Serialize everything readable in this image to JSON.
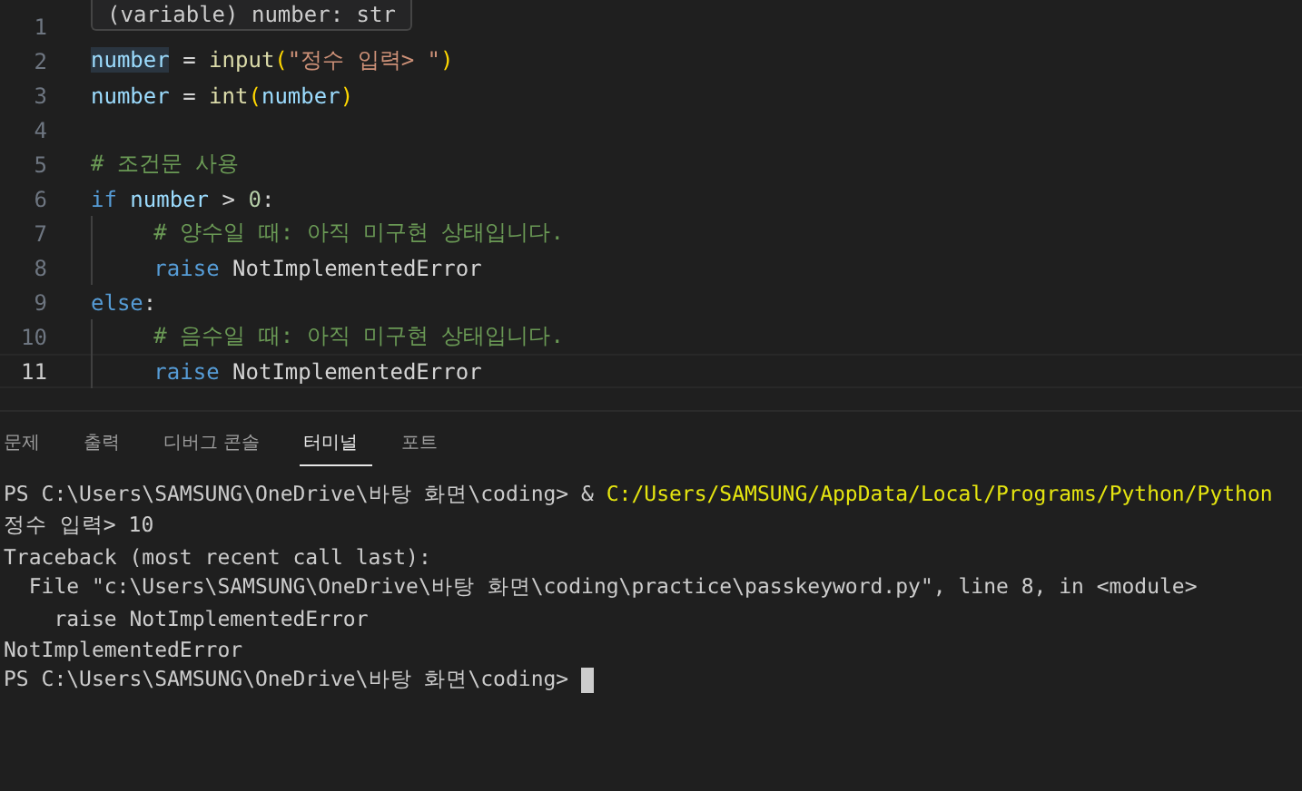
{
  "editor": {
    "tooltip": "(variable) number: str",
    "lines": [
      {
        "number": "1",
        "current": false,
        "indented": false
      },
      {
        "number": "2",
        "current": false,
        "indented": false,
        "tokens": [
          {
            "text": "number",
            "kind": "variable",
            "highlighted": true
          },
          {
            "text": " = ",
            "kind": "plain"
          },
          {
            "text": "input",
            "kind": "function"
          },
          {
            "text": "(",
            "kind": "bracket"
          },
          {
            "text": "\"정수 입력> \"",
            "kind": "string"
          },
          {
            "text": ")",
            "kind": "bracket"
          }
        ]
      },
      {
        "number": "3",
        "current": false,
        "indented": false,
        "tokens": [
          {
            "text": "number",
            "kind": "variable"
          },
          {
            "text": " = ",
            "kind": "plain"
          },
          {
            "text": "int",
            "kind": "function"
          },
          {
            "text": "(",
            "kind": "bracket"
          },
          {
            "text": "number",
            "kind": "variable"
          },
          {
            "text": ")",
            "kind": "bracket"
          }
        ]
      },
      {
        "number": "4",
        "current": false,
        "indented": false
      },
      {
        "number": "5",
        "current": false,
        "indented": false,
        "tokens": [
          {
            "text": "# 조건문 사용",
            "kind": "comment"
          }
        ]
      },
      {
        "number": "6",
        "current": false,
        "indented": false,
        "tokens": [
          {
            "text": "if",
            "kind": "keyword"
          },
          {
            "text": " number",
            "kind": "variable"
          },
          {
            "text": " > ",
            "kind": "plain"
          },
          {
            "text": "0",
            "kind": "number"
          },
          {
            "text": ":",
            "kind": "plain"
          }
        ]
      },
      {
        "number": "7",
        "current": false,
        "indented": true,
        "tokens": [
          {
            "text": "# 양수일 때: 아직 미구현 상태입니다.",
            "kind": "comment"
          }
        ]
      },
      {
        "number": "8",
        "current": false,
        "indented": true,
        "tokens": [
          {
            "text": "raise",
            "kind": "keyword"
          },
          {
            "text": " NotImplementedError",
            "kind": "plain"
          }
        ]
      },
      {
        "number": "9",
        "current": false,
        "indented": false,
        "tokens": [
          {
            "text": "else",
            "kind": "keyword"
          },
          {
            "text": ":",
            "kind": "plain"
          }
        ]
      },
      {
        "number": "10",
        "current": false,
        "indented": true,
        "tokens": [
          {
            "text": "# 음수일 때: 아직 미구현 상태입니다.",
            "kind": "comment"
          }
        ]
      },
      {
        "number": "11",
        "current": true,
        "indented": true,
        "tokens": [
          {
            "text": "raise",
            "kind": "keyword"
          },
          {
            "text": " NotImplementedError",
            "kind": "plain"
          }
        ]
      }
    ]
  },
  "panel": {
    "tabs": [
      {
        "label": "문제",
        "selected": false
      },
      {
        "label": "출력",
        "selected": false
      },
      {
        "label": "디버그 콘솔",
        "selected": false
      },
      {
        "label": "터미널",
        "selected": true
      },
      {
        "label": "포트",
        "selected": false
      }
    ],
    "terminal": [
      {
        "cursor": false,
        "segments": [
          {
            "text": "PS C:\\Users\\SAMSUNG\\OneDrive\\바탕 화면\\coding> & ",
            "kind": "plain"
          },
          {
            "text": "C:/Users/SAMSUNG/AppData/Local/Programs/Python/Python",
            "kind": "path"
          }
        ]
      },
      {
        "cursor": false,
        "segments": [
          {
            "text": "정수 입력> 10",
            "kind": "plain"
          }
        ]
      },
      {
        "cursor": false,
        "segments": [
          {
            "text": "Traceback (most recent call last):",
            "kind": "plain"
          }
        ]
      },
      {
        "cursor": false,
        "segments": [
          {
            "text": "  File \"c:\\Users\\SAMSUNG\\OneDrive\\바탕 화면\\coding\\practice\\passkeyword.py\", line 8, in <module>",
            "kind": "plain"
          }
        ]
      },
      {
        "cursor": false,
        "segments": [
          {
            "text": "    raise NotImplementedError",
            "kind": "plain"
          }
        ]
      },
      {
        "cursor": false,
        "segments": [
          {
            "text": "NotImplementedError",
            "kind": "plain"
          }
        ]
      },
      {
        "cursor": true,
        "segments": [
          {
            "text": "PS C:\\Users\\SAMSUNG\\OneDrive\\바탕 화면\\coding> ",
            "kind": "plain"
          }
        ]
      }
    ]
  }
}
